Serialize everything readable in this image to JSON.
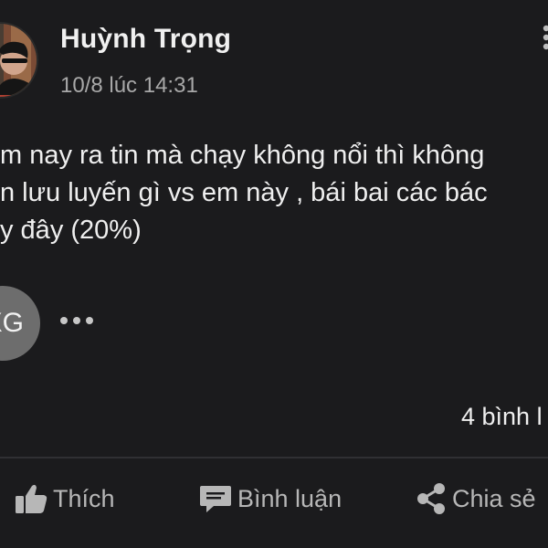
{
  "post": {
    "author_name": "Huỳnh Trọng",
    "timestamp": "10/8 lúc 14:31",
    "text_lines": [
      "m nay ra tin mà chạy không nổi thì không",
      "n lưu luyến gì vs em này , bái bai các bác",
      "y đây (20%)"
    ]
  },
  "reactions": {
    "badge_text": "XG"
  },
  "comments": {
    "count_text": "4 bình l"
  },
  "actions": {
    "like_label": "Thích",
    "comment_label": "Bình luận",
    "share_label": "Chia sẻ"
  },
  "icons": {
    "avatar": "avatar-photo",
    "more_top": "vertical-more-icon",
    "more_reactions": "horizontal-more-icon",
    "like": "thumbs-up-icon",
    "comment": "comment-bubble-icon",
    "share": "share-icon"
  },
  "colors": {
    "background": "#1b1b1d",
    "text": "#efefef",
    "secondary_text": "#a8a8a8",
    "action_text": "#b7b7b7",
    "badge": "#6d6d6d"
  }
}
